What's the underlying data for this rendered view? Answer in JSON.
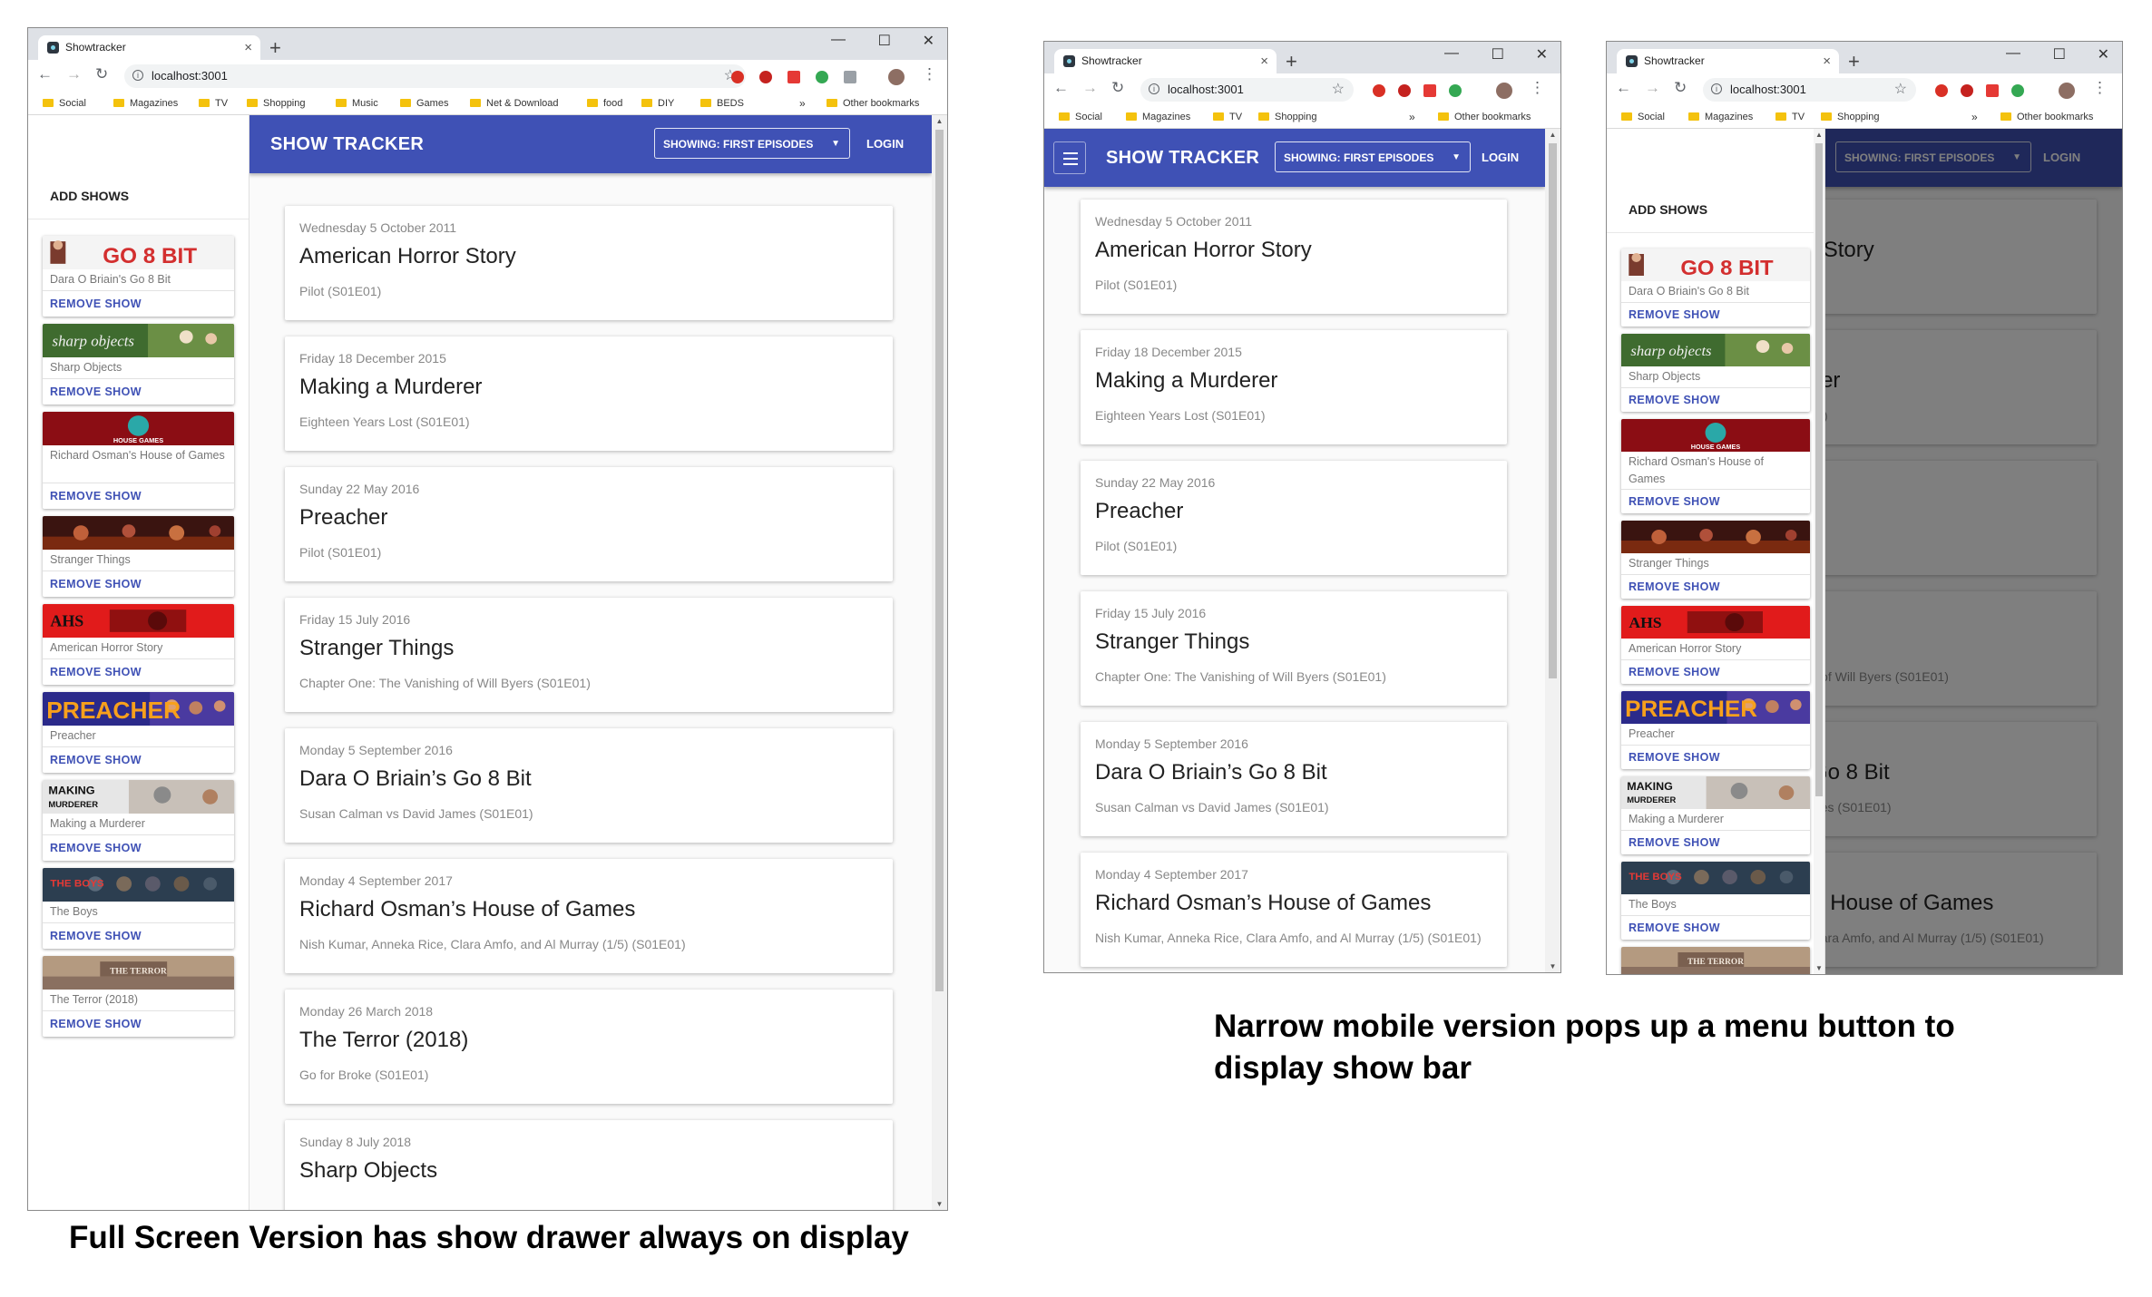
{
  "browser": {
    "tab_title": "Showtracker",
    "close_glyph": "×",
    "new_tab_glyph": "+",
    "window_controls": [
      "—",
      "☐",
      "✕"
    ],
    "nav": {
      "back": "←",
      "forward": "→",
      "reload": "↻",
      "info": "i",
      "star": "☆",
      "menu": "⋮"
    },
    "address": "localhost:3001",
    "bookmarks_wide": [
      "Social",
      "Magazines",
      "TV",
      "Shopping",
      "Music",
      "Games",
      "Net & Download",
      "food",
      "DIY",
      "BEDS"
    ],
    "bookmarks_mid": [
      "Social",
      "Magazines",
      "TV",
      "Shopping"
    ],
    "bookmarks_narrow": [
      "Social",
      "Magazines",
      "TV",
      "Shopping"
    ],
    "overflow_chevron": "»",
    "other_bookmarks": "Other bookmarks",
    "extension_colors": [
      "#d93025",
      "#c5221f",
      "#e53935",
      "#34a853",
      "#5f6368"
    ]
  },
  "app": {
    "title": "SHOW TRACKER",
    "filter_label": "SHOWING: FIRST EPISODES",
    "filter_caret": "▼",
    "login_label": "LOGIN",
    "add_shows_label": "ADD SHOWS",
    "remove_label": "REMOVE SHOW",
    "accent_color": "#3f51b5"
  },
  "drawer_shows": [
    {
      "name": "Dara O Briain's Go 8 Bit",
      "banner": "GO 8 BIT",
      "banner_icon": "go8bit-banner-icon"
    },
    {
      "name": "Sharp Objects",
      "banner": "sharp objects",
      "banner_icon": "sharp-objects-banner-icon"
    },
    {
      "name": "Richard Osman's House of Games",
      "banner": "HOUSE GAMES",
      "banner_icon": "house-of-games-banner-icon"
    },
    {
      "name": "Stranger Things",
      "banner": "",
      "banner_icon": "stranger-things-banner-icon"
    },
    {
      "name": "American Horror Story",
      "banner": "AHS",
      "banner_icon": "ahs-banner-icon"
    },
    {
      "name": "Preacher",
      "banner": "PREACHER",
      "banner_icon": "preacher-banner-icon"
    },
    {
      "name": "Making a Murderer",
      "banner": "MAKING MURDERER",
      "banner_icon": "making-a-murderer-banner-icon"
    },
    {
      "name": "The Boys",
      "banner": "THE BOYS",
      "banner_icon": "the-boys-banner-icon"
    },
    {
      "name": "The Terror (2018)",
      "banner": "THE TERROR",
      "banner_icon": "the-terror-banner-icon"
    }
  ],
  "episodes": [
    {
      "date": "Wednesday 5 October 2011",
      "show": "American Horror Story",
      "episode": "Pilot (S01E01)"
    },
    {
      "date": "Friday 18 December 2015",
      "show": "Making a Murderer",
      "episode": "Eighteen Years Lost (S01E01)"
    },
    {
      "date": "Sunday 22 May 2016",
      "show": "Preacher",
      "episode": "Pilot (S01E01)"
    },
    {
      "date": "Friday 15 July 2016",
      "show": "Stranger Things",
      "episode": "Chapter One: The Vanishing of Will Byers (S01E01)"
    },
    {
      "date": "Monday 5 September 2016",
      "show": "Dara O Briain’s Go 8 Bit",
      "episode": "Susan Calman vs David James (S01E01)"
    },
    {
      "date": "Monday 4 September 2017",
      "show": "Richard Osman’s House of Games",
      "episode": "Nish Kumar, Anneka Rice, Clara Amfo, and Al Murray (1/5) (S01E01)"
    },
    {
      "date": "Monday 26 March 2018",
      "show": "The Terror (2018)",
      "episode": "Go for Broke (S01E01)"
    },
    {
      "date": "Sunday 8 July 2018",
      "show": "Sharp Objects",
      "episode": ""
    }
  ],
  "scroll_arrows": {
    "up": "▲",
    "down": "▼"
  },
  "captions": {
    "full": "Full Screen Version has show drawer always on display",
    "mobile_line1": "Narrow mobile version pops up a menu button to",
    "mobile_line2": "display show bar"
  }
}
